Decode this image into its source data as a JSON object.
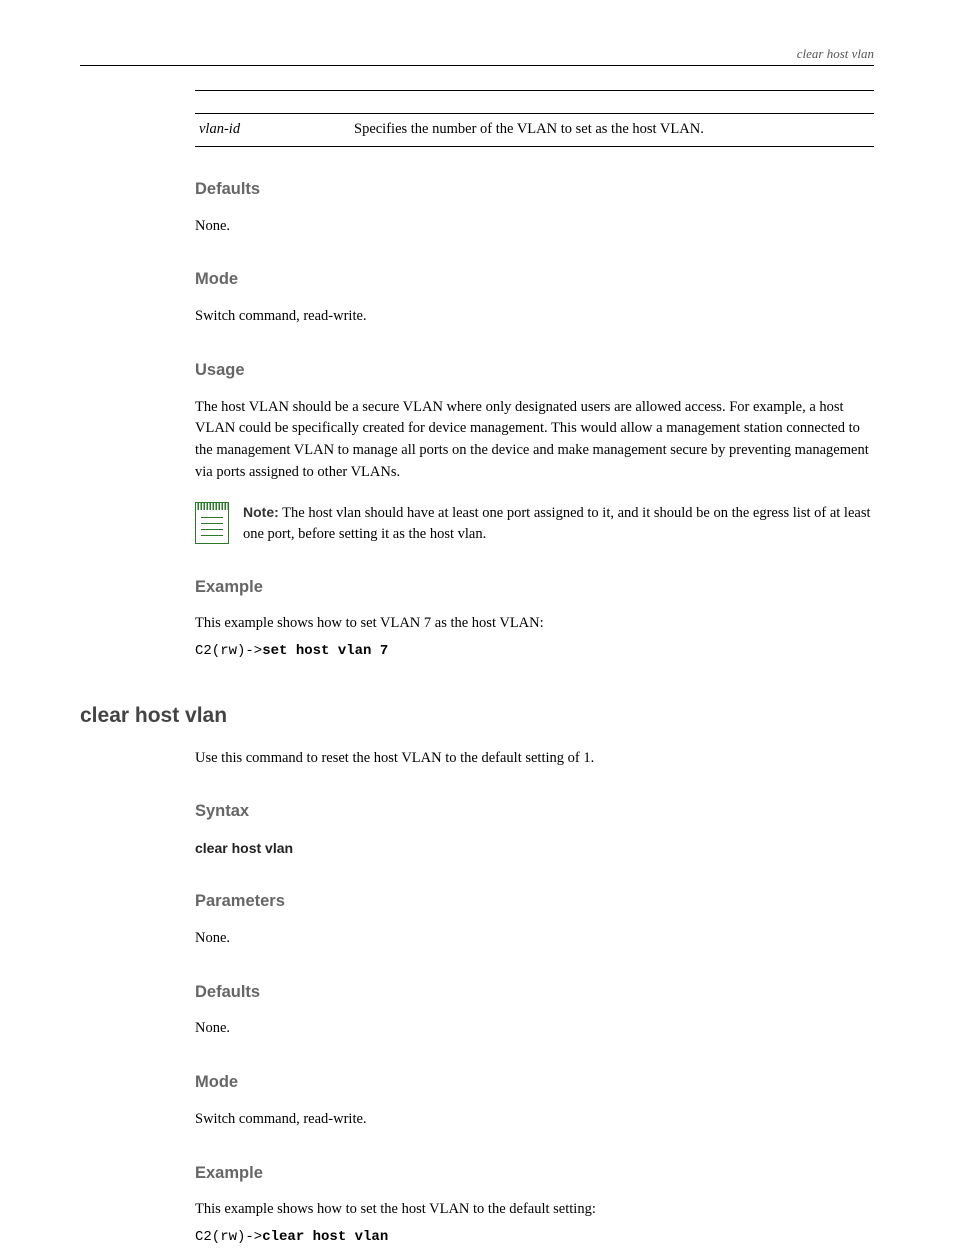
{
  "header": {
    "title": "clear host vlan"
  },
  "table": {
    "name": "vlan-id",
    "desc": "Specifies the number of the VLAN to set as the host VLAN."
  },
  "s_defaults": {
    "heading": "Defaults",
    "text": "None."
  },
  "s_mode": {
    "heading": "Mode",
    "text": "Switch command, read-write."
  },
  "s_usage": {
    "heading": "Usage",
    "text": "The host VLAN should be a secure VLAN where only designated users are allowed access. For example, a host VLAN could be specifically created for device management. This would allow a management station connected to the management VLAN to manage all ports on the device and make management secure by preventing management via ports assigned to other VLANs."
  },
  "note": {
    "lead": "Note:",
    "text": "The host vlan should have at least one port assigned to it, and it should be on the egress list of at least one port, before setting it as the host vlan."
  },
  "s_example": {
    "heading": "Example",
    "text": "This example shows how to set VLAN 7 as the host VLAN:",
    "prompt": "C2(rw)->",
    "cmd": "set host vlan 7"
  },
  "cmd2": {
    "title": "clear host vlan",
    "intro": "Use this command to reset the host VLAN to the default setting of 1.",
    "syntax_label": "Syntax",
    "syntax": "clear host vlan",
    "params_label": "Parameters",
    "params": "None.",
    "defaults_label": "Defaults",
    "defaults": "None.",
    "mode_label": "Mode",
    "mode": "Switch command, read-write.",
    "example_label": "Example",
    "example_text": "This example shows how to set the host VLAN to the default setting:",
    "prompt": "C2(rw)->",
    "cmd": "clear host vlan"
  }
}
